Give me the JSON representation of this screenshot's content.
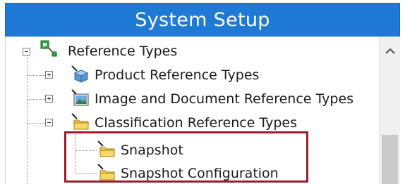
{
  "window": {
    "title": "System Setup"
  },
  "tree": {
    "root": {
      "label": "Reference Types",
      "icon": "network-node-icon",
      "expanded": true
    },
    "items": [
      {
        "label": "Product Reference Types",
        "icon": "cube-icon",
        "expanded": false
      },
      {
        "label": "Image and Document Reference Types",
        "icon": "picture-icon",
        "expanded": false
      },
      {
        "label": "Classification Reference Types",
        "icon": "folder-icon",
        "expanded": true
      }
    ],
    "children": [
      {
        "label": "Snapshot",
        "icon": "folder-icon"
      },
      {
        "label": "Snapshot Configuration",
        "icon": "folder-icon"
      }
    ]
  },
  "colors": {
    "title_bar": "#1f7ad6",
    "highlight": "#9b1c2e",
    "folder": "#f2c94c"
  }
}
